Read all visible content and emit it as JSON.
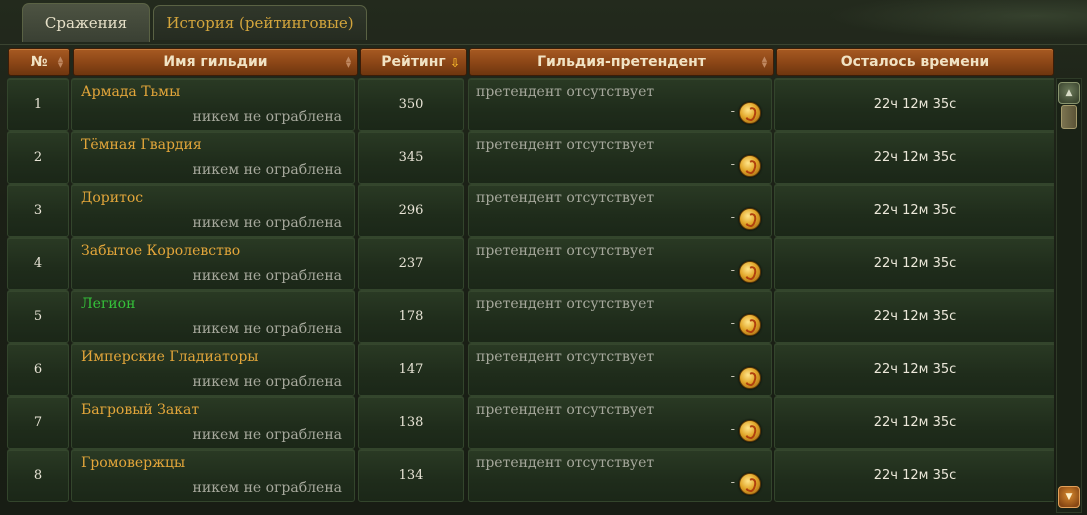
{
  "tabs": [
    {
      "label": "Сражения",
      "active": true
    },
    {
      "label": "История (рейтинговые)",
      "active": false
    }
  ],
  "columns": {
    "num": "№",
    "name": "Имя гильдии",
    "rating": "Рейтинг",
    "challenger": "Гильдия-претендент",
    "time": "Осталось времени"
  },
  "rows": [
    {
      "num": "1",
      "name": "Армада Тьмы",
      "status": "никем не ограблена",
      "rating": "350",
      "challenger": "претендент отсутствует",
      "dash": "-",
      "time": "22ч 12м 35с",
      "name_color": "gold"
    },
    {
      "num": "2",
      "name": "Тёмная Гвардия",
      "status": "никем не ограблена",
      "rating": "345",
      "challenger": "претендент отсутствует",
      "dash": "-",
      "time": "22ч 12м 35с",
      "name_color": "gold"
    },
    {
      "num": "3",
      "name": "Доритос",
      "status": "никем не ограблена",
      "rating": "296",
      "challenger": "претендент отсутствует",
      "dash": "-",
      "time": "22ч 12м 35с",
      "name_color": "gold"
    },
    {
      "num": "4",
      "name": "Забытое Королевство",
      "status": "никем не ограблена",
      "rating": "237",
      "challenger": "претендент отсутствует",
      "dash": "-",
      "time": "22ч 12м 35с",
      "name_color": "gold"
    },
    {
      "num": "5",
      "name": "Легион",
      "status": "никем не ограблена",
      "rating": "178",
      "challenger": "претендент отсутствует",
      "dash": "-",
      "time": "22ч 12м 35с",
      "name_color": "green"
    },
    {
      "num": "6",
      "name": "Имперские Гладиаторы",
      "status": "никем не ограблена",
      "rating": "147",
      "challenger": "претендент отсутствует",
      "dash": "-",
      "time": "22ч 12м 35с",
      "name_color": "gold"
    },
    {
      "num": "7",
      "name": "Багровый Закат",
      "status": "никем не ограблена",
      "rating": "138",
      "challenger": "претендент отсутствует",
      "dash": "-",
      "time": "22ч 12м 35с",
      "name_color": "gold"
    },
    {
      "num": "8",
      "name": "Громовержцы",
      "status": "никем не ограблена",
      "rating": "134",
      "challenger": "претендент отсутствует",
      "dash": "-",
      "time": "22ч 12м 35с",
      "name_color": "gold"
    }
  ],
  "icons": {
    "challenger_coin": "gold-coin-icon",
    "sort": "sort-arrows-icon",
    "sort_active": "sort-desc-icon",
    "scroll_up": "scroll-up-icon",
    "scroll_down": "scroll-down-icon"
  },
  "colors": {
    "gold_text": "#e3a63a",
    "green_text": "#35c33a",
    "header_bg": "#8a4516"
  }
}
